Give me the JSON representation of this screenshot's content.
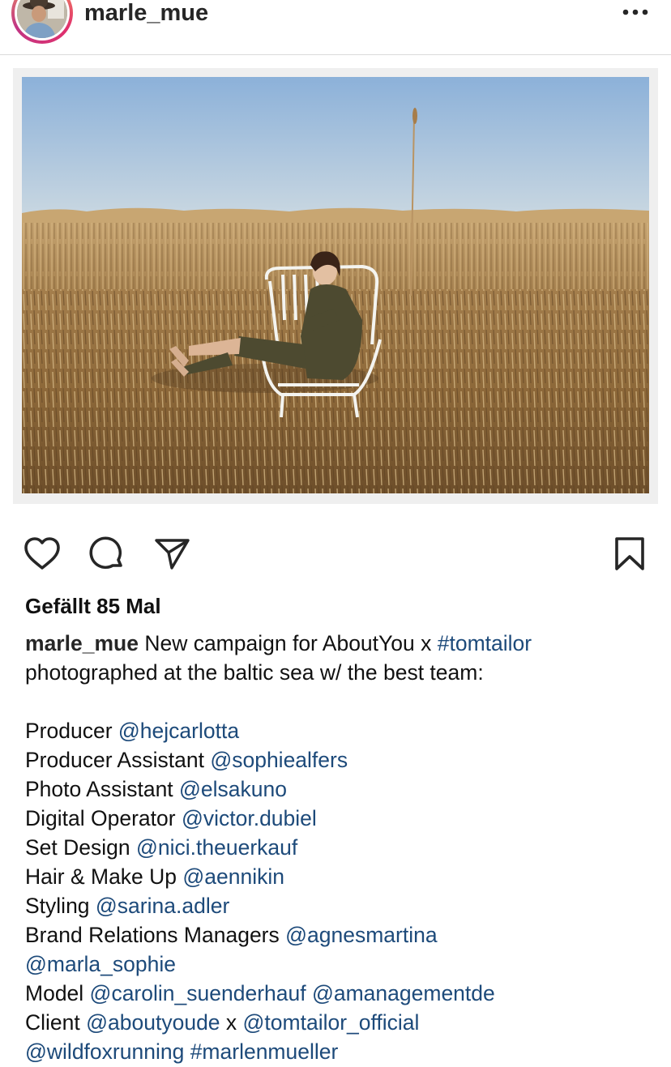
{
  "post": {
    "username": "marle_mue",
    "likes": "Gefällt 85 Mal"
  },
  "icons": {
    "more": "more-options-icon",
    "like": "heart-icon",
    "comment": "comment-icon",
    "share": "paper-plane-icon",
    "save": "bookmark-icon"
  },
  "caption": {
    "intro_text": " New campaign for AboutYou x ",
    "intro_tag": "#tomtailor",
    "line2": "photographed at the baltic sea w/ the best team:",
    "credits": {
      "producer_label": "Producer ",
      "producer_handle": "@hejcarlotta",
      "producer_assistant_label": "Producer Assistant ",
      "producer_assistant_handle": "@sophiealfers",
      "photo_assistant_label": "Photo Assistant ",
      "photo_assistant_handle": "@elsakuno",
      "digital_operator_label": "Digital Operator ",
      "digital_operator_handle": "@victor.dubiel",
      "set_design_label": "Set Design ",
      "set_design_handle": "@nici.theuerkauf",
      "hair_makeup_label": "Hair & Make Up ",
      "hair_makeup_handle": "@aennikin",
      "styling_label": "Styling ",
      "styling_handle": "@sarina.adler",
      "brand_relations_label": "Brand Relations Managers ",
      "brand_relations_handle_1": "@agnesmartina",
      "brand_relations_handle_2": "@marla_sophie",
      "model_label": "Model ",
      "model_handle_1": "@carolin_suenderhauf",
      "model_handle_2": "@amanagementde",
      "client_label": "Client ",
      "client_handle_1": "@aboutyoude",
      "client_sep": " x ",
      "client_handle_2": "@tomtailor_official",
      "final_handle": "@wildfoxrunning",
      "final_tag": "#marlenmueller"
    }
  },
  "colors": {
    "mention": "#1d4a7a",
    "text": "#111111",
    "divider": "#dbdbdb"
  }
}
